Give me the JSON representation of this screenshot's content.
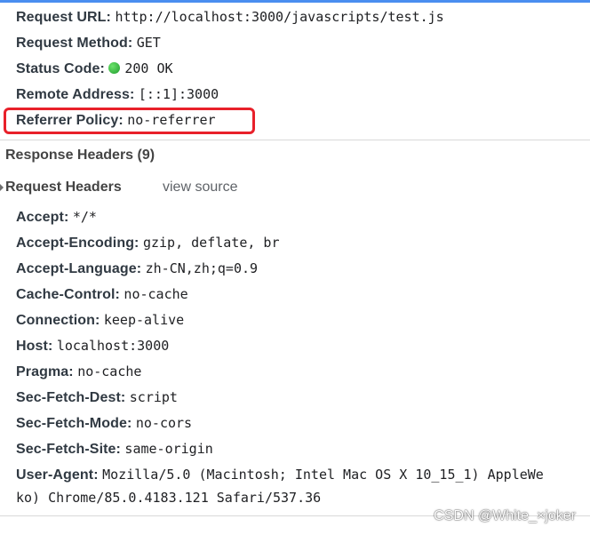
{
  "general": {
    "request_url": {
      "key": "Request URL:",
      "value": "http://localhost:3000/javascripts/test.js"
    },
    "request_method": {
      "key": "Request Method:",
      "value": "GET"
    },
    "status_code": {
      "key": "Status Code:",
      "value": "200 OK",
      "indicator_color": "#2ea043"
    },
    "remote_address": {
      "key": "Remote Address:",
      "value": "[::1]:3000"
    },
    "referrer_policy": {
      "key": "Referrer Policy:",
      "value": "no-referrer",
      "highlight_color": "#e8202a"
    }
  },
  "response_headers": {
    "title": "Response Headers (9)"
  },
  "request_headers": {
    "title": "Request Headers",
    "view_source_label": "view source",
    "items": [
      {
        "key": "Accept:",
        "value": "*/*"
      },
      {
        "key": "Accept-Encoding:",
        "value": "gzip, deflate, br"
      },
      {
        "key": "Accept-Language:",
        "value": "zh-CN,zh;q=0.9"
      },
      {
        "key": "Cache-Control:",
        "value": "no-cache"
      },
      {
        "key": "Connection:",
        "value": "keep-alive"
      },
      {
        "key": "Host:",
        "value": "localhost:3000"
      },
      {
        "key": "Pragma:",
        "value": "no-cache"
      },
      {
        "key": "Sec-Fetch-Dest:",
        "value": "script"
      },
      {
        "key": "Sec-Fetch-Mode:",
        "value": "no-cors"
      },
      {
        "key": "Sec-Fetch-Site:",
        "value": "same-origin"
      },
      {
        "key": "User-Agent:",
        "value": "Mozilla/5.0 (Macintosh; Intel Mac OS X 10_15_1) AppleWe"
      }
    ],
    "user_agent_continuation": "ko) Chrome/85.0.4183.121 Safari/537.36"
  },
  "watermark": "CSDN @White_×joker",
  "colors": {
    "accent": "#4a8ef0",
    "highlight_border": "#e8202a",
    "status_green": "#2ea043"
  }
}
